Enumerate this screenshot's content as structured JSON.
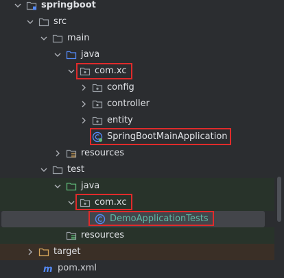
{
  "tree": {
    "root": "springboot",
    "src": "src",
    "main": "main",
    "main_java": "java",
    "main_package": "com.xc",
    "config": "config",
    "controller": "controller",
    "entity": "entity",
    "main_class": "SpringBootMainApplication",
    "main_resources": "resources",
    "test": "test",
    "test_java": "java",
    "test_package": "com.xc",
    "test_class": "DemoApplicationTests",
    "test_resources": "resources",
    "target": "target",
    "pom": "pom.xml"
  },
  "colors": {
    "background": "#2b2d30",
    "folder_blue": "#548af7",
    "folder_gray": "#9aa0a6",
    "folder_green": "#5fb878",
    "folder_orange": "#d4a45a",
    "test_text": "#5fb8a5",
    "highlight": "#e02b2b",
    "selection": "#43454a"
  }
}
